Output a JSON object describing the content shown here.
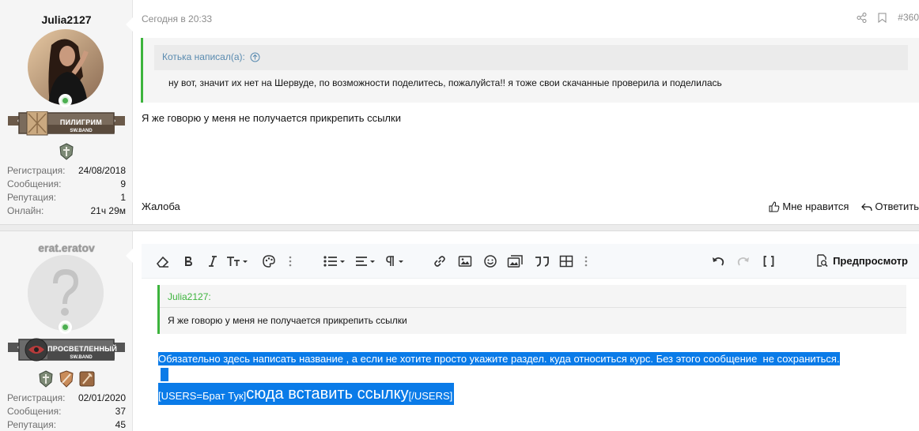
{
  "post1": {
    "username": "Julia2127",
    "rank_title": "ПИЛИГРИМ",
    "rank_sub": "SW.BAND",
    "stats": [
      {
        "label": "Регистрация:",
        "value": "24/08/2018"
      },
      {
        "label": "Сообщения:",
        "value": "9"
      },
      {
        "label": "Репутация:",
        "value": "1"
      },
      {
        "label": "Онлайн:",
        "value": "21ч 29м"
      }
    ],
    "date": "Сегодня в 20:33",
    "post_number": "#360",
    "quote_author": "Котька написал(а):",
    "quote_text": "ну вот, значит их нет на Шервуде, по возможности поделитесь, пожалуйста!! я тоже свои скачанные проверила и поделилась",
    "message": "Я же говорю у меня не получается прикрепить ссылки",
    "report": "Жалоба",
    "like": "Мне нравится",
    "reply": "Ответить"
  },
  "post2": {
    "username": "erat.eratov",
    "rank_title": "ПРОСВЕТЛЕННЫЙ",
    "rank_sub": "SW.BAND",
    "stats": [
      {
        "label": "Регистрация:",
        "value": "02/01/2020"
      },
      {
        "label": "Сообщения:",
        "value": "37"
      },
      {
        "label": "Репутация:",
        "value": "45"
      }
    ],
    "toolbar": {
      "preview": "Предпросмотр"
    },
    "editor_quote_author": "Julia2127:",
    "editor_quote_text": "Я же говорю у меня не получается прикрепить ссылки",
    "line1": "Обязательно здесь написать название , а если не хотите просто укажите раздел. куда относиться курс. Без этого сообщение  не сохраниться.",
    "line3_open": "[USERS=Брат Тук]",
    "line3_main": "сюда вставить ссылку",
    "line3_close": "[/USERS]"
  },
  "colors": {
    "selection": "#0a7be8",
    "quote_bar": "#3db43d",
    "online": "#4caf50"
  }
}
